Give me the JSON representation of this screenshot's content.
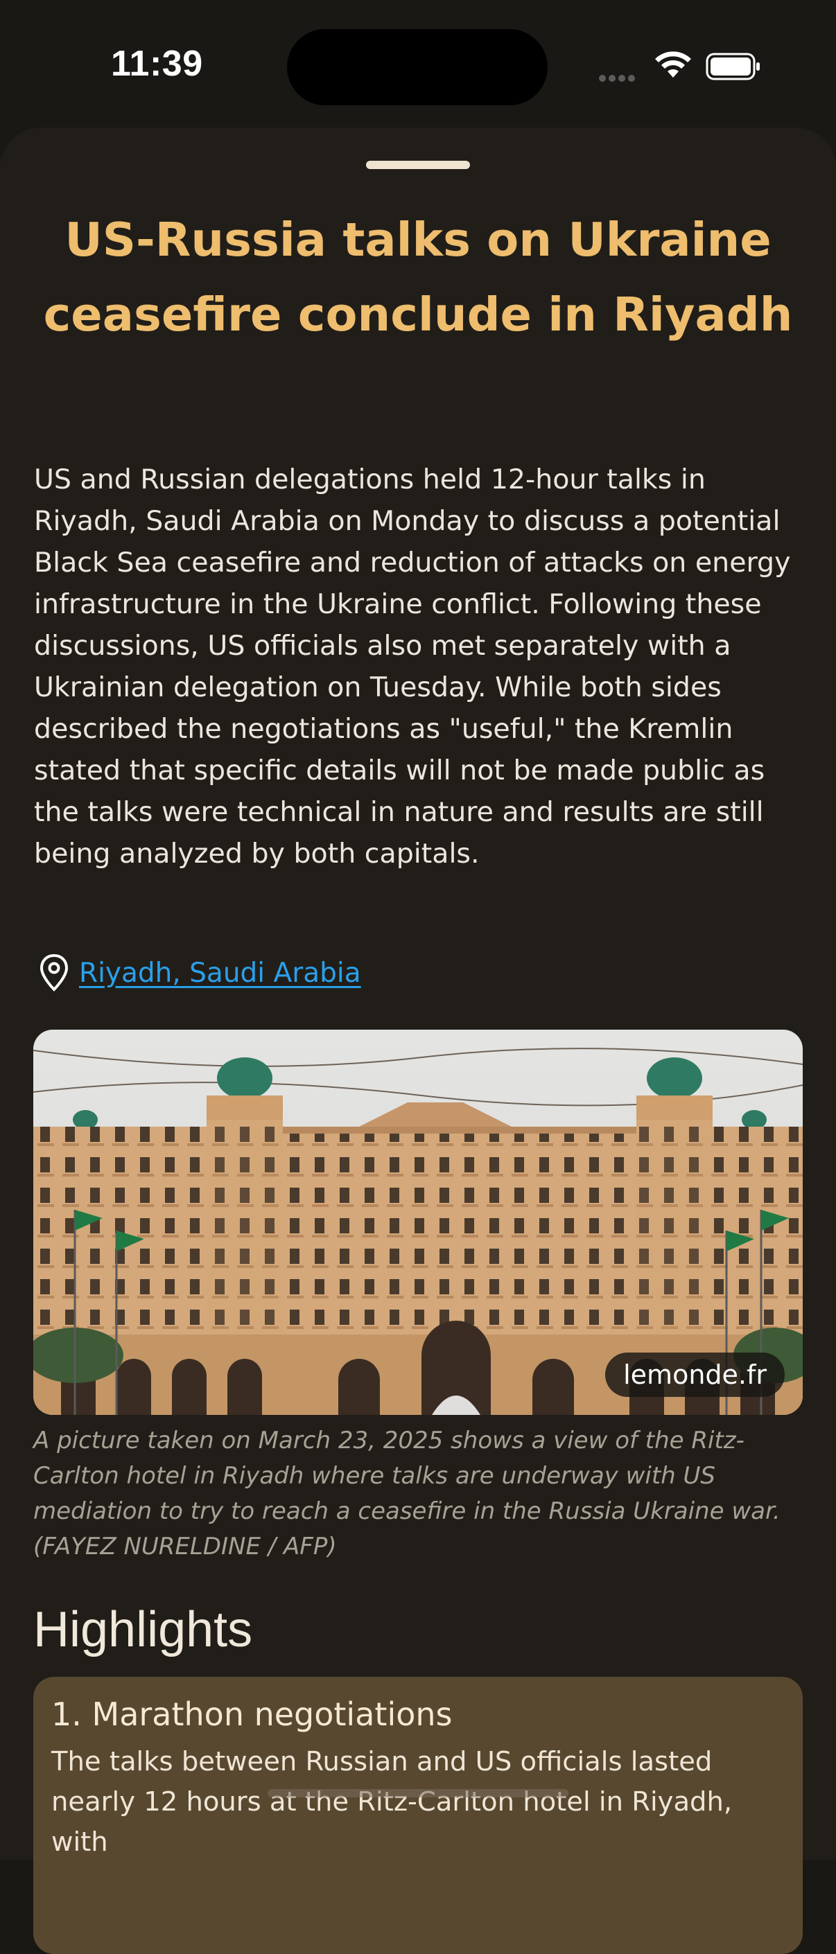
{
  "status_bar": {
    "time": "11:39"
  },
  "article": {
    "headline": "US-Russia talks on Ukraine ceasefire conclude in Riyadh",
    "summary": "US and Russian delegations held 12-hour talks in Riyadh, Saudi Arabia on Monday to discuss a potential Black Sea ceasefire and reduction of attacks on energy infrastructure in the Ukraine conflict. Following these discussions, US officials also met separately with a Ukrainian delegation on Tuesday. While both sides described the negotiations as \"useful,\" the Kremlin stated that specific details will not be made public as the talks were technical in nature and results are still being analyzed by both capitals.",
    "location": "Riyadh, Saudi Arabia",
    "image": {
      "source": "lemonde.fr",
      "caption": "A picture taken on March 23, 2025 shows a view of the Ritz-Carlton hotel in Riyadh where talks are underway with US mediation to try to reach a ceasefire in the Russia Ukraine war. (FAYEZ NURELDINE / AFP)"
    }
  },
  "highlights": {
    "heading": "Highlights",
    "items": [
      {
        "title": "1. Marathon negotiations",
        "body": "The talks between Russian and US officials lasted nearly 12 hours at the Ritz-Carlton hotel in Riyadh, with"
      }
    ]
  },
  "colors": {
    "background": "#1a1814",
    "sheet": "#211e19",
    "headline": "#eebd6e",
    "link": "#2aa0ea",
    "card": "#594830"
  },
  "icons": [
    "wifi-icon",
    "battery-icon",
    "location-pin-icon"
  ]
}
